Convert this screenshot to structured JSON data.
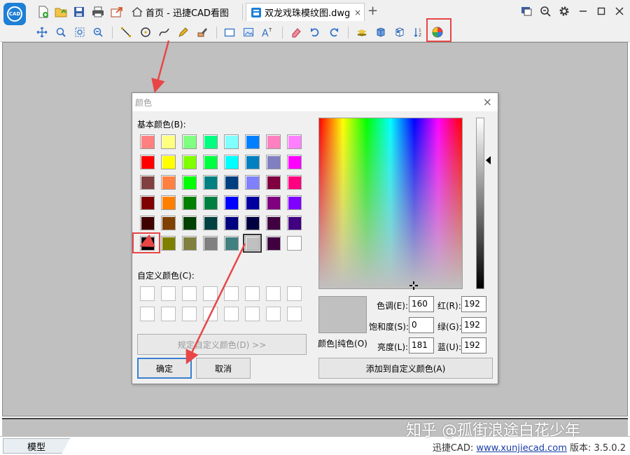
{
  "titlebar": {
    "logo_text": "CAD",
    "home_tab": "首页 - 迅捷CAD看图",
    "file_tab": "双龙戏珠模纹图.dwg",
    "file_tab_close": "×",
    "new_tab": "+",
    "window_controls": [
      "minimize",
      "maximize",
      "close"
    ]
  },
  "toolbar": {
    "icons": [
      "pan-icon",
      "zoom-icon",
      "zoom-window-icon",
      "zoom-extents-icon",
      "line-icon",
      "circle-icon",
      "polyline-icon",
      "pencil-icon",
      "eraser-edit-icon",
      "rectangle-icon",
      "image-icon",
      "text-icon",
      "eraser-icon",
      "undo-icon",
      "redo-icon",
      "layer-icon",
      "cube-icon",
      "3d-view-icon",
      "sort-icon",
      "color-icon"
    ],
    "accent": "#e84646"
  },
  "dialog": {
    "title": "颜色",
    "close": "×",
    "basic_colors_label": "基本颜色(B):",
    "basic_colors": [
      [
        "#ff8080",
        "#ffff80",
        "#80ff80",
        "#00ff80",
        "#80ffff",
        "#0080ff",
        "#ff80c0",
        "#ff80ff"
      ],
      [
        "#ff0000",
        "#ffff00",
        "#80ff00",
        "#00ff40",
        "#00ffff",
        "#0080c0",
        "#8080c0",
        "#ff00ff"
      ],
      [
        "#804040",
        "#ff8040",
        "#00ff00",
        "#008080",
        "#004080",
        "#8080ff",
        "#800040",
        "#ff0080"
      ],
      [
        "#800000",
        "#ff8000",
        "#008000",
        "#008040",
        "#0000ff",
        "#0000a0",
        "#800080",
        "#8000ff"
      ],
      [
        "#400000",
        "#804000",
        "#004000",
        "#004040",
        "#000080",
        "#000040",
        "#400040",
        "#400080"
      ],
      [
        "#000000",
        "#808000",
        "#808040",
        "#808080",
        "#408080",
        "#c0c0c0",
        "#400040",
        "#ffffff"
      ]
    ],
    "custom_colors_label": "自定义颜色(C):",
    "define_button": "规定自定义颜色(D) >>",
    "ok_button": "确定",
    "cancel_button": "取消",
    "color_solid_label": "颜色|纯色(O)",
    "hue_label": "色调(E):",
    "hue": "160",
    "sat_label": "饱和度(S):",
    "sat": "0",
    "lum_label": "亮度(L):",
    "lum": "181",
    "red_label": "红(R):",
    "red": "192",
    "green_label": "绿(G):",
    "green": "192",
    "blue_label": "蓝(U):",
    "blue": "192",
    "add_custom_button": "添加到自定义颜色(A)",
    "preview_color": "#c0c0c0",
    "selected_index": [
      5,
      5
    ]
  },
  "statusbar": {
    "model_tab": "模型",
    "brand_prefix": "迅捷CAD: ",
    "brand_link": "www.xunjiecad.com",
    "version": " 版本: 3.5.0.2"
  },
  "watermark": "知乎 @孤街浪途白花少年"
}
